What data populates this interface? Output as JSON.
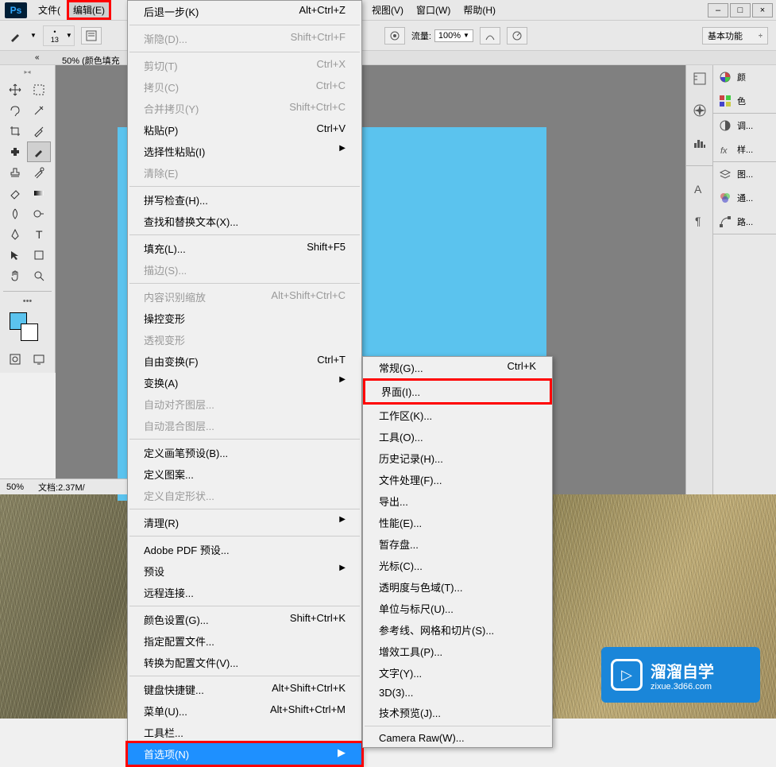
{
  "app": {
    "logo": "Ps"
  },
  "menubar": {
    "file": "文件(",
    "edit": "编辑(E)",
    "view": "视图(V)",
    "window": "窗口(W)",
    "help": "帮助(H)"
  },
  "options": {
    "brush_size": "13",
    "flow_label": "流量:",
    "flow_value": "100%",
    "workspace": "基本功能"
  },
  "doc_tab": "50% (颜色填充",
  "status": {
    "zoom": "50%",
    "docinfo": "文档:2.37M/"
  },
  "right_panels": {
    "color": "颜",
    "swatches": "色",
    "adjustments": "调...",
    "styles": "样...",
    "layers": "图...",
    "channels": "通...",
    "paths": "路..."
  },
  "edit_menu": {
    "undo": {
      "label": "后退一步(K)",
      "shortcut": "Alt+Ctrl+Z"
    },
    "fade": {
      "label": "渐隐(D)...",
      "shortcut": "Shift+Ctrl+F"
    },
    "cut": {
      "label": "剪切(T)",
      "shortcut": "Ctrl+X"
    },
    "copy": {
      "label": "拷贝(C)",
      "shortcut": "Ctrl+C"
    },
    "copy_merged": {
      "label": "合并拷贝(Y)",
      "shortcut": "Shift+Ctrl+C"
    },
    "paste": {
      "label": "粘贴(P)",
      "shortcut": "Ctrl+V"
    },
    "paste_special": {
      "label": "选择性粘贴(I)"
    },
    "clear": {
      "label": "清除(E)"
    },
    "spell": {
      "label": "拼写检查(H)..."
    },
    "find_replace": {
      "label": "查找和替换文本(X)..."
    },
    "fill": {
      "label": "填充(L)...",
      "shortcut": "Shift+F5"
    },
    "stroke": {
      "label": "描边(S)..."
    },
    "content_aware": {
      "label": "内容识别缩放",
      "shortcut": "Alt+Shift+Ctrl+C"
    },
    "puppet_warp": {
      "label": "操控变形"
    },
    "perspective_warp": {
      "label": "透视变形"
    },
    "free_transform": {
      "label": "自由变换(F)",
      "shortcut": "Ctrl+T"
    },
    "transform": {
      "label": "变换(A)"
    },
    "auto_align": {
      "label": "自动对齐图层..."
    },
    "auto_blend": {
      "label": "自动混合图层..."
    },
    "define_brush": {
      "label": "定义画笔预设(B)..."
    },
    "define_pattern": {
      "label": "定义图案..."
    },
    "define_shape": {
      "label": "定义自定形状..."
    },
    "purge": {
      "label": "清理(R)"
    },
    "pdf_presets": {
      "label": "Adobe PDF 预设..."
    },
    "presets": {
      "label": "预设"
    },
    "remote": {
      "label": "远程连接..."
    },
    "color_settings": {
      "label": "颜色设置(G)...",
      "shortcut": "Shift+Ctrl+K"
    },
    "assign_profile": {
      "label": "指定配置文件..."
    },
    "convert_profile": {
      "label": "转换为配置文件(V)..."
    },
    "keyboard": {
      "label": "键盘快捷键...",
      "shortcut": "Alt+Shift+Ctrl+K"
    },
    "menus": {
      "label": "菜单(U)...",
      "shortcut": "Alt+Shift+Ctrl+M"
    },
    "toolbar": {
      "label": "工具栏..."
    },
    "preferences": {
      "label": "首选项(N)"
    }
  },
  "sub_menu": {
    "general": {
      "label": "常规(G)...",
      "shortcut": "Ctrl+K"
    },
    "interface": {
      "label": "界面(I)..."
    },
    "workspace": {
      "label": "工作区(K)..."
    },
    "tools": {
      "label": "工具(O)..."
    },
    "history": {
      "label": "历史记录(H)..."
    },
    "file_handling": {
      "label": "文件处理(F)..."
    },
    "export": {
      "label": "导出..."
    },
    "performance": {
      "label": "性能(E)..."
    },
    "scratch": {
      "label": "暂存盘..."
    },
    "cursors": {
      "label": "光标(C)..."
    },
    "transparency": {
      "label": "透明度与色域(T)..."
    },
    "units": {
      "label": "单位与标尺(U)..."
    },
    "guides": {
      "label": "参考线、网格和切片(S)..."
    },
    "plugins": {
      "label": "增效工具(P)..."
    },
    "type": {
      "label": "文字(Y)..."
    },
    "threed": {
      "label": "3D(3)..."
    },
    "tech_preview": {
      "label": "技术预览(J)..."
    },
    "camera_raw": {
      "label": "Camera Raw(W)..."
    }
  },
  "watermark": {
    "title": "溜溜自学",
    "url": "zixue.3d66.com"
  }
}
